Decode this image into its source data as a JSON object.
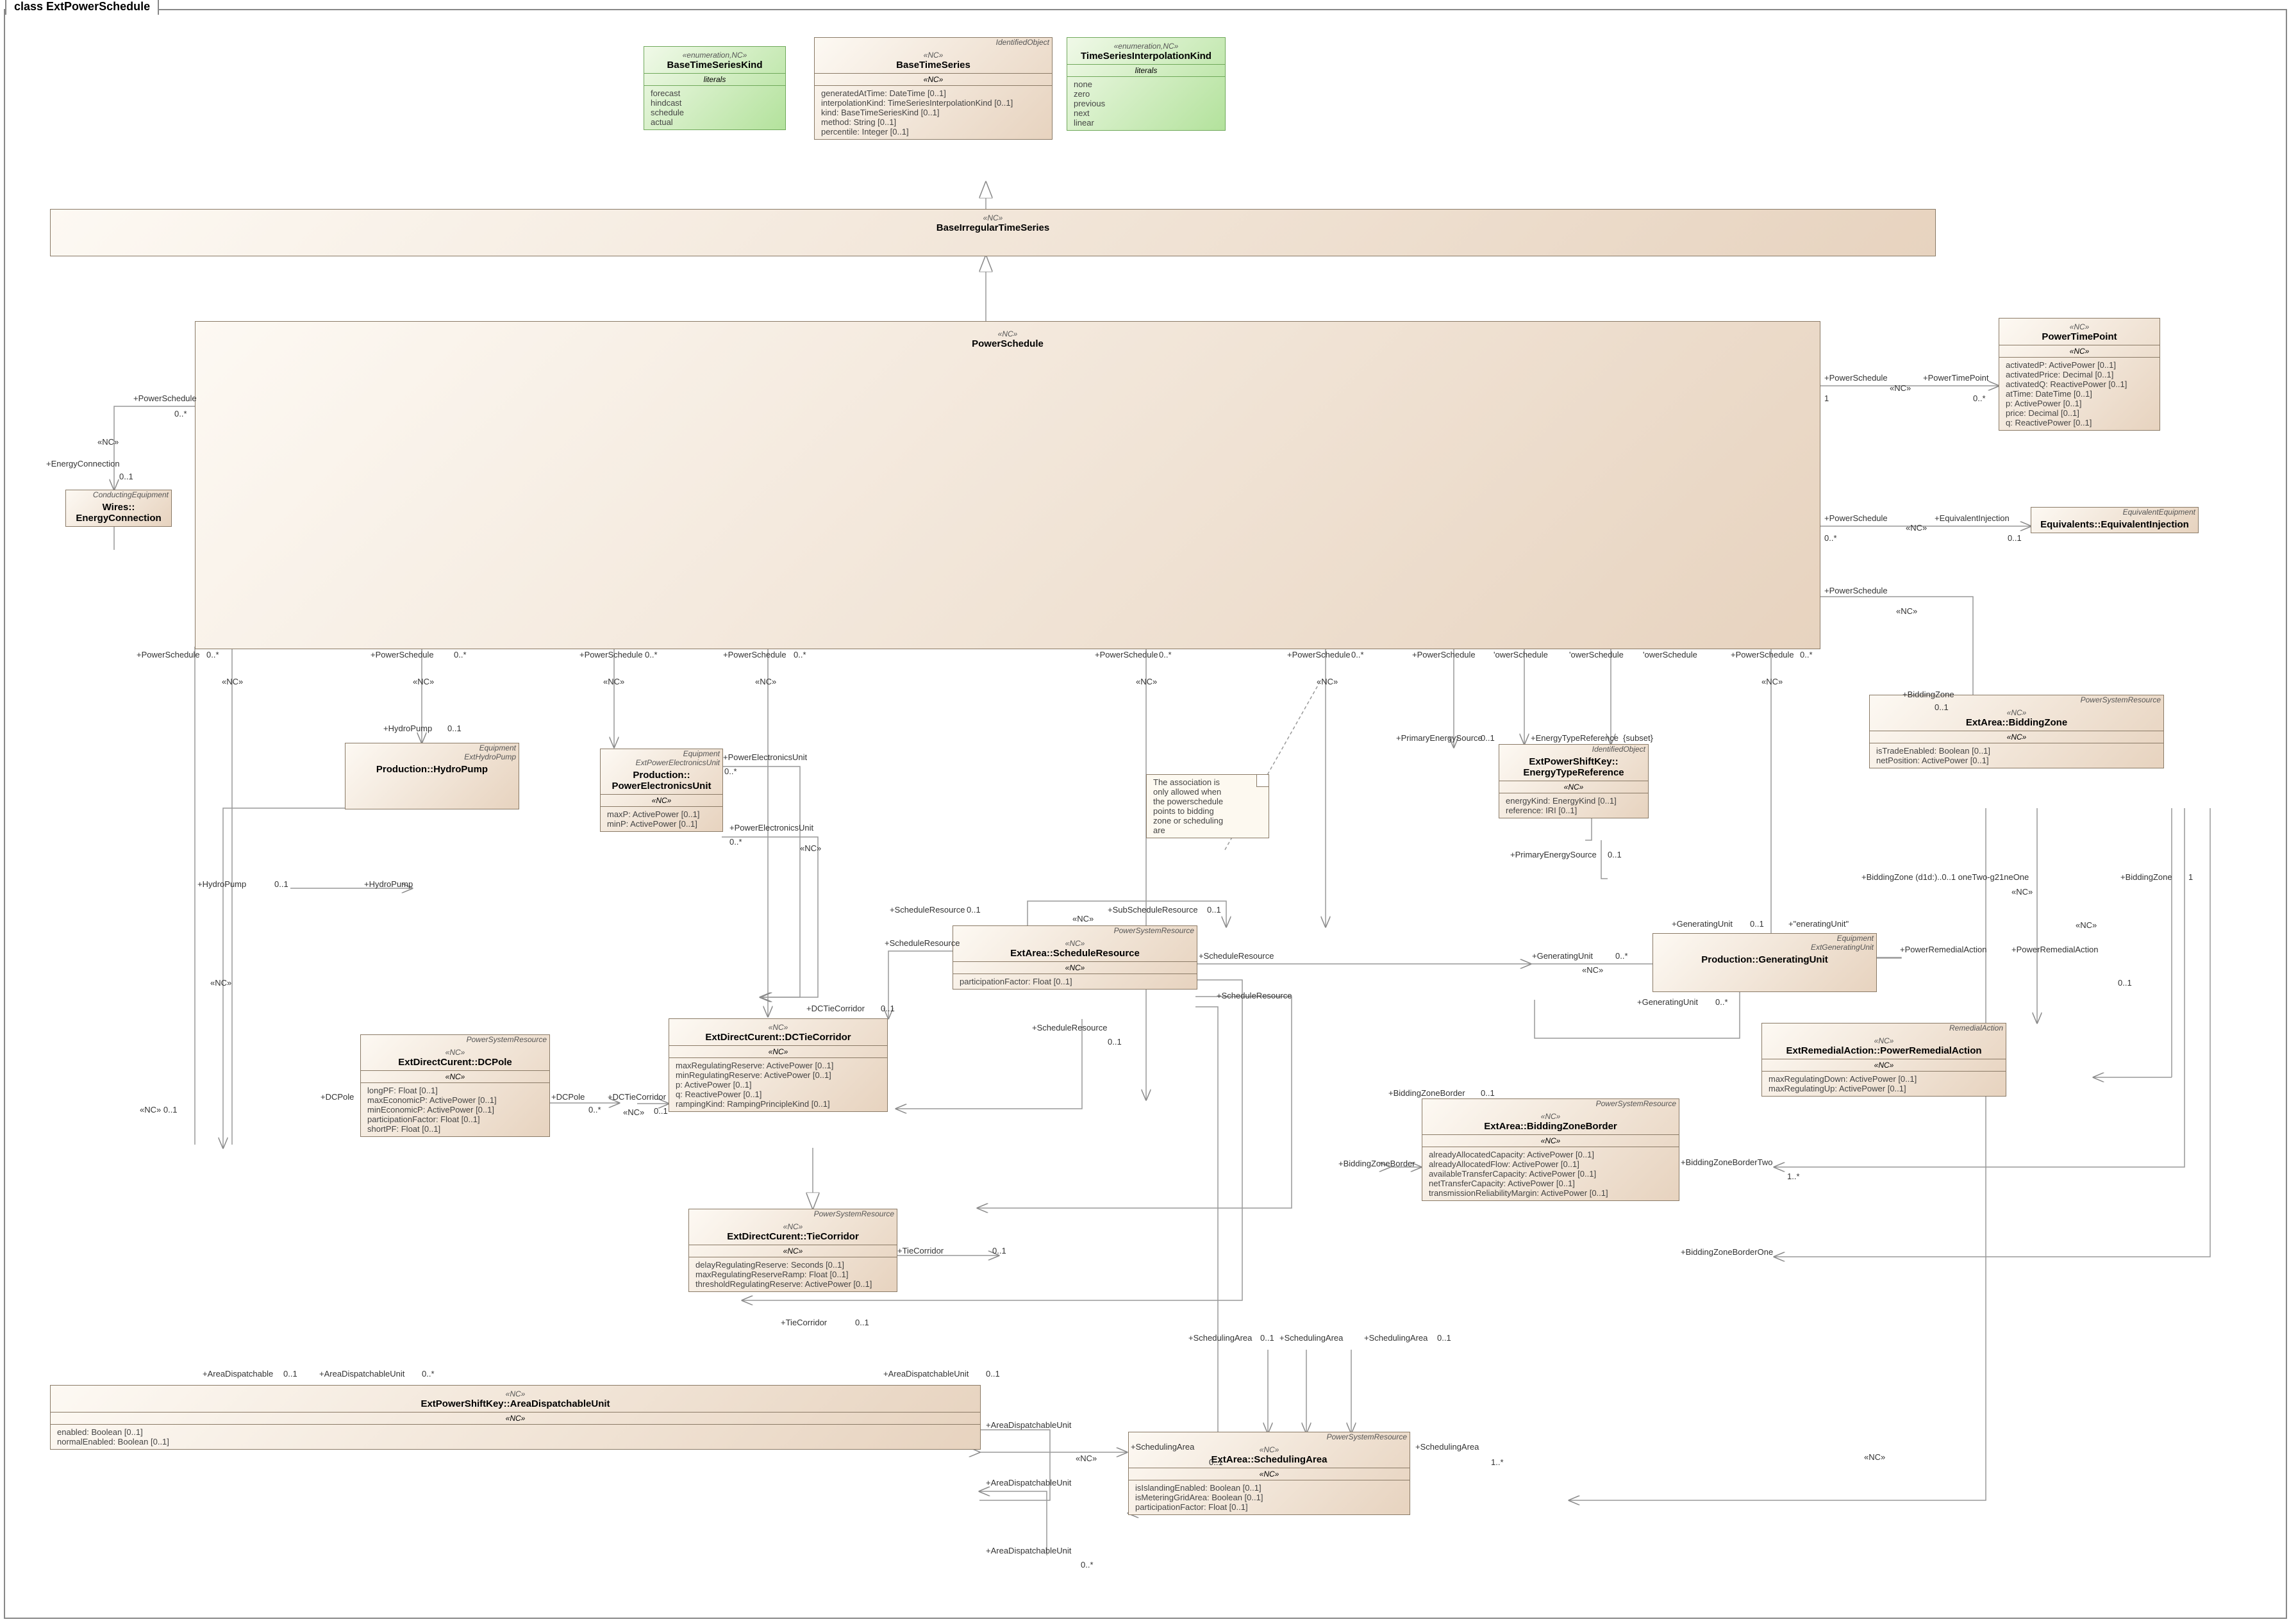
{
  "diagramTitle": "class ExtPowerSchedule",
  "stereotypes": {
    "nc": "«NC»",
    "enum": "«enumeration,NC»"
  },
  "superclasses": {
    "identified": "IdentifiedObject",
    "conducting": "ConductingEquipment",
    "equipment": "Equipment",
    "extHydroPump": "ExtHydroPump",
    "extPEU": "ExtPowerElectronicsUnit",
    "psr": "PowerSystemResource",
    "extGU": "ExtGeneratingUnit",
    "ra": "RemedialAction",
    "eqEq": "EquivalentEquipment"
  },
  "classes": {
    "baseTSKind": {
      "name": "BaseTimeSeriesKind",
      "literals": [
        "forecast",
        "hindcast",
        "schedule",
        "actual"
      ],
      "section": "literals"
    },
    "tsInterpKind": {
      "name": "TimeSeriesInterpolationKind",
      "literals": [
        "none",
        "zero",
        "previous",
        "next",
        "linear"
      ],
      "section": "literals"
    },
    "baseTS": {
      "name": "BaseTimeSeries",
      "attrs": [
        "generatedAtTime: DateTime [0..1]",
        "interpolationKind: TimeSeriesInterpolationKind [0..1]",
        "kind: BaseTimeSeriesKind [0..1]",
        "method: String [0..1]",
        "percentile: Integer [0..1]"
      ]
    },
    "baseIrregTS": {
      "name": "BaseIrregularTimeSeries"
    },
    "powerSchedule": {
      "name": "PowerSchedule"
    },
    "wiresEC": {
      "name": "Wires::\nEnergyConnection"
    },
    "hydroPump": {
      "name": "Production::HydroPump"
    },
    "peu": {
      "name": "Production::\nPowerElectronicsUnit",
      "attrs": [
        "maxP: ActivePower [0..1]",
        "minP: ActivePower [0..1]"
      ]
    },
    "energyTypeRef": {
      "name": "ExtPowerShiftKey::\nEnergyTypeReference",
      "attrs": [
        "energyKind: EnergyKind [0..1]",
        "reference: IRI [0..1]"
      ]
    },
    "schedRes": {
      "name": "ExtArea::ScheduleResource",
      "attrs": [
        "participationFactor: Float [0..1]"
      ]
    },
    "genUnit": {
      "name": "Production::GeneratingUnit"
    },
    "dcPole": {
      "name": "ExtDirectCurent::DCPole",
      "attrs": [
        "longPF: Float [0..1]",
        "maxEconomicP: ActivePower [0..1]",
        "minEconomicP: ActivePower [0..1]",
        "participationFactor: Float [0..1]",
        "shortPF: Float [0..1]"
      ]
    },
    "dcTieCor": {
      "name": "ExtDirectCurent::DCTieCorridor",
      "attrs": [
        "maxRegulatingReserve: ActivePower [0..1]",
        "minRegulatingReserve: ActivePower [0..1]",
        "p: ActivePower [0..1]",
        "q: ReactivePower [0..1]",
        "rampingKind: RampingPrincipleKind [0..1]"
      ]
    },
    "tieCor": {
      "name": "ExtDirectCurent::TieCorridor",
      "attrs": [
        "delayRegulatingReserve: Seconds [0..1]",
        "maxRegulatingReserveRamp: Float [0..1]",
        "thresholdRegulatingReserve: ActivePower [0..1]"
      ]
    },
    "bzBorder": {
      "name": "ExtArea::BiddingZoneBorder",
      "attrs": [
        "alreadyAllocatedCapacity: ActivePower [0..1]",
        "alreadyAllocatedFlow: ActivePower [0..1]",
        "availableTransferCapacity: ActivePower [0..1]",
        "netTransferCapacity: ActivePower [0..1]",
        "transmissionReliabilityMargin: ActivePower [0..1]"
      ]
    },
    "adu": {
      "name": "ExtPowerShiftKey::AreaDispatchableUnit",
      "attrs": [
        "enabled: Boolean [0..1]",
        "normalEnabled: Boolean [0..1]"
      ]
    },
    "schedArea": {
      "name": "ExtArea::SchedulingArea",
      "attrs": [
        "isIslandingEnabled: Boolean [0..1]",
        "isMeteringGridArea: Boolean [0..1]",
        "participationFactor: Float [0..1]"
      ]
    },
    "bz": {
      "name": "ExtArea::BiddingZone",
      "attrs": [
        "isTradeEnabled: Boolean [0..1]",
        "netPosition: ActivePower [0..1]"
      ]
    },
    "ptp": {
      "name": "PowerTimePoint",
      "attrs": [
        "activatedP: ActivePower [0..1]",
        "activatedPrice: Decimal [0..1]",
        "activatedQ: ReactivePower [0..1]",
        "atTime: DateTime [0..1]",
        "p: ActivePower [0..1]",
        "price: Decimal [0..1]",
        "q: ReactivePower [0..1]"
      ]
    },
    "eqInj": {
      "name": "Equivalents::EquivalentInjection"
    },
    "pra": {
      "name": "ExtRemedialAction::PowerRemedialAction",
      "attrs": [
        "maxRegulatingDown: ActivePower [0..1]",
        "maxRegulatingUp: ActivePower [0..1]"
      ]
    }
  },
  "note": {
    "l1": "The association is",
    "l2": "only allowed when",
    "l3": "the powerschedule",
    "l4": "points to bidding",
    "l5": "zone or scheduling",
    "l6": "are"
  },
  "labels": {
    "powerSchedule": "+PowerSchedule",
    "energyConnection": "+EnergyConnection",
    "hydroPump": "+HydroPump",
    "peu": "+PowerElectronicsUnit",
    "dcPole": "+DCPole",
    "dcTieCor": "+DCTieCorridor",
    "tieCor": "+TieCorridor",
    "primaryES": "+PrimaryEnergySource",
    "energyTR": "+EnergyTypeReference",
    "biddingZoneNS": "+BiddingZone  (d1d:)..0..1 oneTwo-g21neOne",
    "bz": "+BiddingZone",
    "subset": "{subset}",
    "schedRes": "+ScheduleResource",
    "subSchedRes": "+SubScheduleResource",
    "genUnit": "+GeneratingUnit",
    "energUnit": "+\"eneratingUnit\"",
    "bzBorder": "+BiddingZoneBorder",
    "bzBorder1": "+BiddingZoneBorderOne",
    "bzBorder2": "+BiddingZoneBorderTwo",
    "pra": "+PowerRemedialAction",
    "ptp": "+PowerTimePoint",
    "eqInj": "+EquivalentInjection",
    "schedArea": "+SchedulingArea",
    "adu": "+AreaDispatchableUnit",
    "areaDU": "+AreaDispatchable",
    "m0s": "0..*",
    "m01": "0..1",
    "m1": "1",
    "mNC": "«NC»"
  }
}
